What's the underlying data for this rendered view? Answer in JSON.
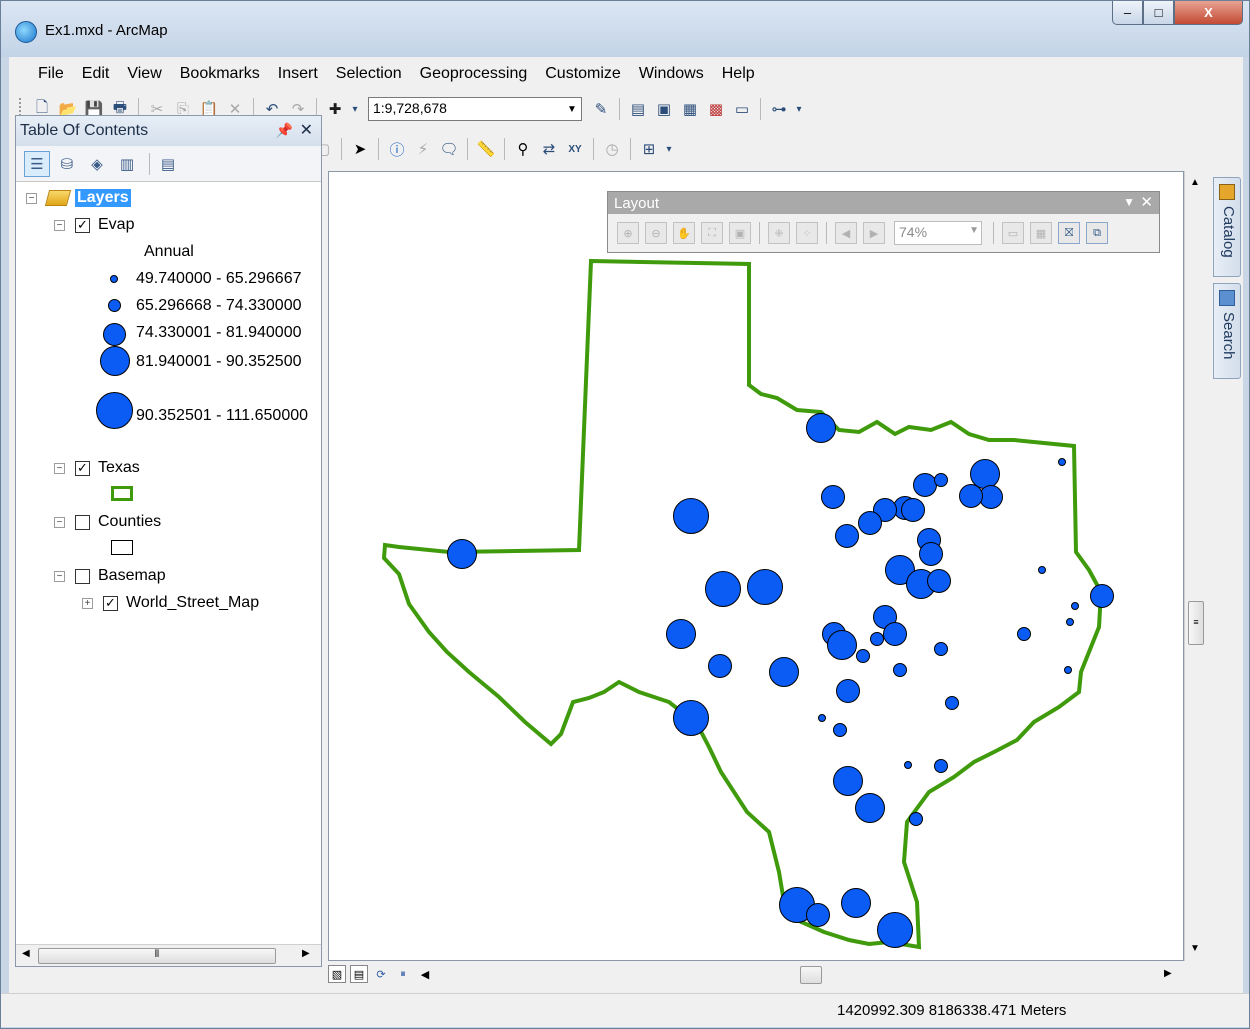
{
  "window": {
    "title": "Ex1.mxd - ArcMap",
    "controls": {
      "minimize": "–",
      "maximize": "□",
      "close": "X"
    }
  },
  "menu": [
    "File",
    "Edit",
    "View",
    "Bookmarks",
    "Insert",
    "Selection",
    "Geoprocessing",
    "Customize",
    "Windows",
    "Help"
  ],
  "toolbar": {
    "scale": "1:9,728,678"
  },
  "toc": {
    "title": "Table Of Contents",
    "root_label": "Layers",
    "evap_label": "Evap",
    "evap_field": "Annual",
    "evap_classes": [
      "49.740000 - 65.296667",
      "65.296668 - 74.330000",
      "74.330001 - 81.940000",
      "81.940001 - 90.352500",
      "90.352501 - 111.650000"
    ],
    "texas_label": "Texas",
    "counties_label": "Counties",
    "basemap_label": "Basemap",
    "world_street_label": "World_Street_Map",
    "checked": {
      "evap": true,
      "texas": true,
      "counties": false,
      "basemap": false,
      "world_street": true
    }
  },
  "layout_toolbar": {
    "title": "Layout",
    "zoom": "74%"
  },
  "side_tabs": {
    "catalog": "Catalog",
    "search": "Search"
  },
  "status": {
    "coords": "1420992.309  8186338.471 Meters"
  },
  "map": {
    "outline_color": "#3f9b0b",
    "point_color": "#0a5cf5",
    "points": [
      {
        "c": 3
      },
      {
        "c": 3
      },
      {
        "c": 2
      },
      {
        "c": 2
      },
      {
        "c": 2
      },
      {
        "c": 1
      },
      {
        "c": 1
      }
    ]
  }
}
